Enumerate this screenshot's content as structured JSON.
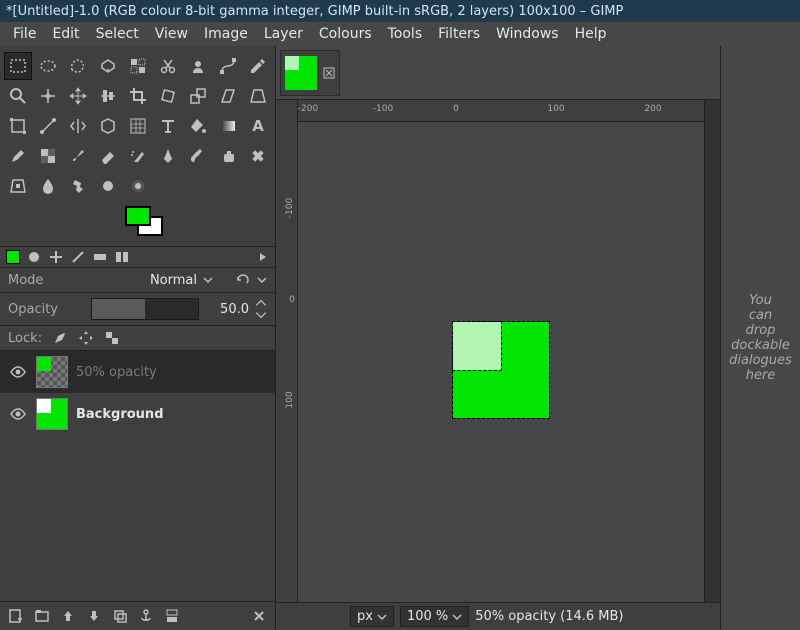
{
  "window_title": "*[Untitled]-1.0 (RGB colour 8-bit gamma integer, GIMP built-in sRGB, 2 layers) 100x100 – GIMP",
  "menu": {
    "file": "File",
    "edit": "Edit",
    "select": "Select",
    "view": "View",
    "image": "Image",
    "layer": "Layer",
    "colours": "Colours",
    "tools": "Tools",
    "filters": "Filters",
    "windows": "Windows",
    "help": "Help"
  },
  "colors": {
    "fg": "#00e600",
    "bg": "#ffffff"
  },
  "layers_panel": {
    "mode_label": "Mode",
    "mode_value": "Normal",
    "opacity_label": "Opacity",
    "opacity_value": "50.0",
    "lock_label": "Lock:"
  },
  "layers": [
    {
      "name": "50% opacity",
      "visible": true,
      "active": true
    },
    {
      "name": "Background",
      "visible": true,
      "active": false,
      "bold": true
    }
  ],
  "ruler_h": [
    "-200",
    "-100",
    "0",
    "100",
    "200"
  ],
  "ruler_v": [
    "-100",
    "0",
    "100"
  ],
  "status": {
    "unit": "px",
    "zoom": "100 %",
    "text": "50% opacity (14.6 MB)"
  },
  "dock_hint": [
    "You",
    "can",
    "drop",
    "dockable",
    "dialogues",
    "here"
  ]
}
